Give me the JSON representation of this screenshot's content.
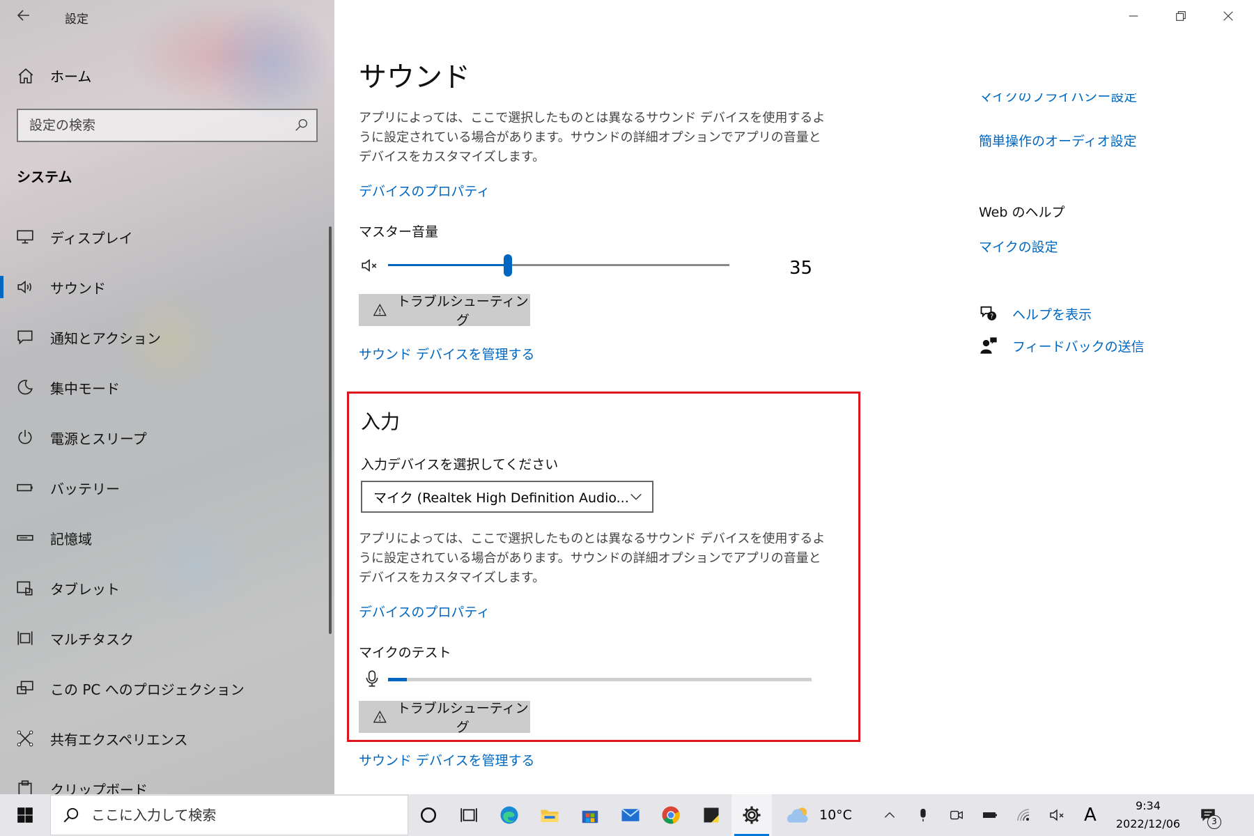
{
  "window": {
    "title": "設定"
  },
  "sidebar": {
    "home_label": "ホーム",
    "search_placeholder": "設定の検索",
    "section_title": "システム",
    "items": [
      {
        "label": "ディスプレイ",
        "icon": "display-icon"
      },
      {
        "label": "サウンド",
        "icon": "speaker-icon",
        "active": true
      },
      {
        "label": "通知とアクション",
        "icon": "notification-icon"
      },
      {
        "label": "集中モード",
        "icon": "moon-icon"
      },
      {
        "label": "電源とスリープ",
        "icon": "power-icon"
      },
      {
        "label": "バッテリー",
        "icon": "battery-icon"
      },
      {
        "label": "記憶域",
        "icon": "storage-icon"
      },
      {
        "label": "タブレット",
        "icon": "tablet-icon"
      },
      {
        "label": "マルチタスク",
        "icon": "multitask-icon"
      },
      {
        "label": "この PC へのプロジェクション",
        "icon": "projection-icon"
      },
      {
        "label": "共有エクスペリエンス",
        "icon": "share-icon"
      },
      {
        "label": "クリップボード",
        "icon": "clipboard-icon"
      }
    ]
  },
  "main": {
    "title": "サウンド",
    "output": {
      "description": "アプリによっては、ここで選択したものとは異なるサウンド デバイスを使用するように設定されている場合があります。サウンドの詳細オプションでアプリの音量とデバイスをカスタマイズします。",
      "device_properties_link": "デバイスのプロパティ",
      "master_volume_label": "マスター音量",
      "volume_value": "35",
      "volume_fraction": 0.35,
      "troubleshoot_label": "トラブルシューティング",
      "manage_devices_link": "サウンド デバイスを管理する"
    },
    "input": {
      "title": "入力",
      "select_label": "入力デバイスを選択してください",
      "selected_device": "マイク (Realtek High Definition Audio...",
      "description": "アプリによっては、ここで選択したものとは異なるサウンド デバイスを使用するように設定されている場合があります。サウンドの詳細オプションでアプリの音量とデバイスをカスタマイズします。",
      "device_properties_link": "デバイスのプロパティ",
      "mic_test_label": "マイクのテスト",
      "mic_level_fraction": 0.045,
      "troubleshoot_label": "トラブルシューティング",
      "manage_devices_link": "サウンド デバイスを管理する"
    }
  },
  "right": {
    "partial_link": "マイクのプライバシー設定",
    "accessibility_link": "簡単操作のオーディオ設定",
    "web_help_title": "Web のヘルプ",
    "mic_settings_link": "マイクの設定",
    "help_link": "ヘルプを表示",
    "feedback_link": "フィードバックの送信"
  },
  "taskbar": {
    "search_placeholder": "ここに入力して検索",
    "weather_temp": "10°C",
    "ime_indicator": "A",
    "time": "9:34",
    "date": "2022/12/06",
    "notification_count": "3"
  },
  "colors": {
    "accent": "#0067c0",
    "highlight_border": "#e0141f",
    "button_bg": "#cccccc"
  }
}
